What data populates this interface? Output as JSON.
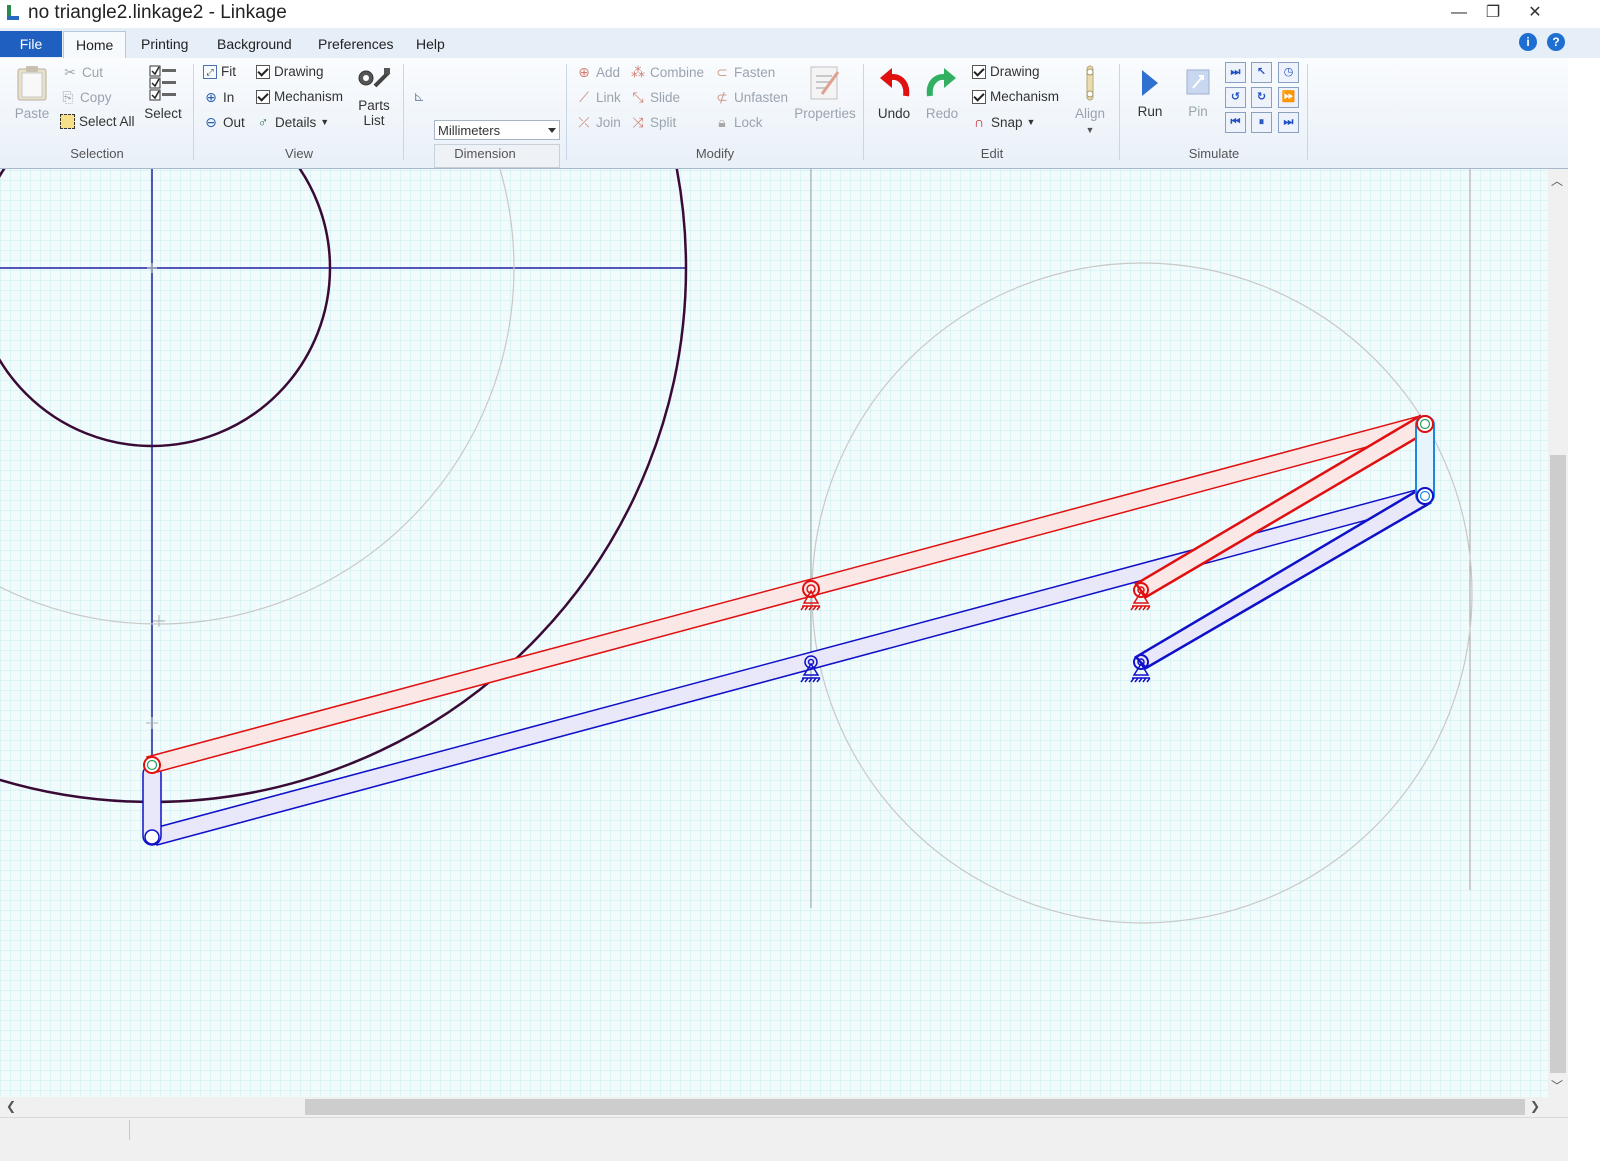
{
  "window": {
    "title": "no triangle2.linkage2 - Linkage",
    "minimize": "—",
    "maximize": "❐",
    "close": "✕"
  },
  "menu": {
    "file": "File",
    "tabs": [
      "Home",
      "Printing",
      "Background",
      "Preferences",
      "Help"
    ],
    "active_tab": "Home"
  },
  "ribbon": {
    "selection": {
      "label": "Selection",
      "paste": "Paste",
      "cut": "Cut",
      "copy": "Copy",
      "select_all": "Select All",
      "select": "Select"
    },
    "view": {
      "label": "View",
      "fit": "Fit",
      "in": "In",
      "out": "Out",
      "drawing": "Drawing",
      "mechanism": "Mechanism",
      "details": "Details",
      "parts_list_1": "Parts",
      "parts_list_2": "List"
    },
    "dimension": {
      "label": "Dimension",
      "units": "Millimeters",
      "value": ""
    },
    "modify": {
      "label": "Modify",
      "add": "Add",
      "link": "Link",
      "join": "Join",
      "combine": "Combine",
      "slide": "Slide",
      "split": "Split",
      "fasten": "Fasten",
      "unfasten": "Unfasten",
      "lock": "Lock",
      "properties": "Properties"
    },
    "edit": {
      "label": "Edit",
      "undo": "Undo",
      "redo": "Redo",
      "drawing": "Drawing",
      "mechanism": "Mechanism",
      "snap": "Snap",
      "align": "Align"
    },
    "simulate": {
      "label": "Simulate",
      "run": "Run",
      "pin": "Pin"
    }
  },
  "colors": {
    "accent": "#1f5fbf",
    "red_link": "#e01010",
    "blue_link": "#1010c8",
    "drawing": "#3a0a36",
    "grid": "#c6ecf0"
  }
}
